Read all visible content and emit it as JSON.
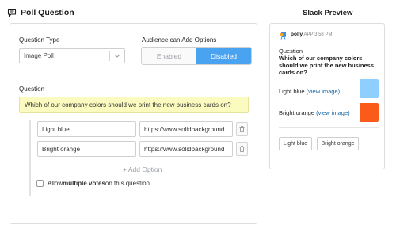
{
  "header": {
    "title": "Poll Question",
    "icon": "poll-chat-icon"
  },
  "editor": {
    "question_type_label": "Question Type",
    "question_type_value": "Image Poll",
    "audience_label": "Audience can Add Options",
    "audience_options": [
      "Enabled",
      "Disabled"
    ],
    "audience_selected": "Disabled",
    "question_label": "Question",
    "question_value": "Which of our company colors should we print the new business cards on?",
    "options": [
      {
        "name": "Light blue",
        "url": "https://www.solidbackground"
      },
      {
        "name": "Bright orange",
        "url": "https://www.solidbackground"
      }
    ],
    "add_option_label": "+ Add Option",
    "checkbox": {
      "prefix": "Allow ",
      "bold": "multiple votes",
      "suffix": " on this question",
      "checked": false
    }
  },
  "preview": {
    "title": "Slack Preview",
    "bot_name": "polly",
    "app_tag": "APP",
    "time": "3:58 PM",
    "label": "Question",
    "question": "Which of our company colors should we print the new business cards on?",
    "options": [
      {
        "name": "Light blue",
        "link": "(view image)",
        "color": "#8ecfff"
      },
      {
        "name": "Bright orange",
        "link": "(view image)",
        "color": "#fa5b1a"
      }
    ],
    "buttons": [
      "Light blue",
      "Bright orange"
    ]
  },
  "colors": {
    "accent": "#4aa3f0",
    "question_bg": "#fbfbbf"
  }
}
